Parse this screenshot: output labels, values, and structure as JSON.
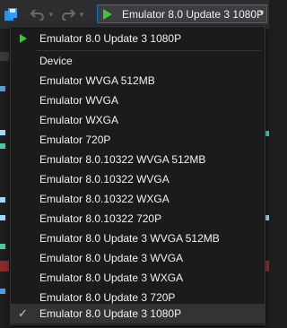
{
  "toolbar": {
    "save_icon": "save-all-icon",
    "undo_icon": "undo-icon",
    "redo_icon": "redo-icon",
    "run_target": "Emulator 8.0 Update 3 1080P",
    "accent": "#007acc",
    "play_color": "#3ec43e"
  },
  "menu": {
    "top_item": "Emulator 8.0 Update 3 1080P",
    "items": [
      "Device",
      "Emulator WVGA 512MB",
      "Emulator WVGA",
      "Emulator WXGA",
      "Emulator 720P",
      "Emulator 8.0.10322 WVGA 512MB",
      "Emulator 8.0.10322 WVGA",
      "Emulator 8.0.10322 WXGA",
      "Emulator 8.0.10322 720P",
      "Emulator 8.0 Update 3 WVGA 512MB",
      "Emulator 8.0 Update 3 WVGA",
      "Emulator 8.0 Update 3 WXGA",
      "Emulator 8.0 Update 3 720P",
      "Emulator 8.0 Update 3 1080P"
    ],
    "checked_item": "Emulator 8.0 Update 3 1080P"
  }
}
